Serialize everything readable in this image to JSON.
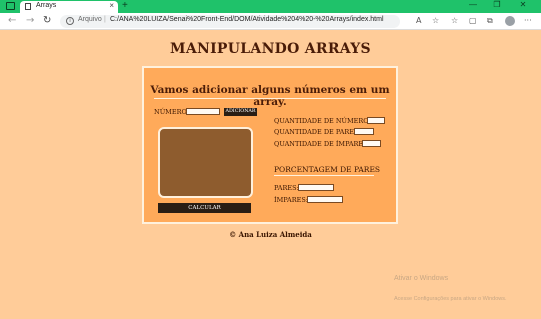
{
  "browser": {
    "tab_title": "Arrays",
    "tab_close": "×",
    "new_tab": "+",
    "address_label": "Arquivo",
    "address_separator": "|",
    "url": "C:/ANA%20LUIZA/Senai%20Front-End/DOM/Atividade%204%20-%20Arrays/index.html",
    "nav": {
      "back": "←",
      "forward": "→",
      "reload": "↻"
    },
    "window_controls": {
      "minimize": "—",
      "restore": "❐",
      "close": "✕"
    },
    "toolbar_icons": [
      "read-aloud-icon",
      "favorite-add-icon",
      "favorites-icon",
      "collections-icon",
      "extensions-icon",
      "profile-icon",
      "menu-icon"
    ],
    "toolbar_glyphs": {
      "read_aloud": "A",
      "favorite_add": "☆",
      "favorites": "☆",
      "collections": "▢",
      "extensions": "⧉",
      "menu": "···"
    }
  },
  "page": {
    "title": "MANIPULANDO ARRAYS",
    "heading": "Vamos adicionar alguns números em um array.",
    "number_label": "NÚMERO:",
    "number_value": "",
    "add_button": "ADICIONAR",
    "calculate_button": "CALCULAR",
    "stats": {
      "qty_numbers_label": "QUANTIDADE DE NÚMEROS:",
      "qty_even_label": "QUANTIDADE DE PARES:",
      "qty_odd_label": "QUANTIDADE DE ÍMPARES:"
    },
    "percentage_heading": "PORCENTAGEM DE PARES",
    "even_label": "PARES:",
    "odd_label": "ÍMPARES:",
    "footer": "© Ana Luiza Almeida"
  },
  "os_overlay": {
    "activate_title": "Ativar o Windows",
    "activate_subtitle": "Acesse Configurações para ativar o Windows."
  },
  "colors": {
    "background": "#ffcc99",
    "card": "#ffaa5a",
    "listbox": "#8e5c2e",
    "title_text": "#4a1c08",
    "button": "#2a1e14",
    "tab_bar": "#1fc26a"
  }
}
